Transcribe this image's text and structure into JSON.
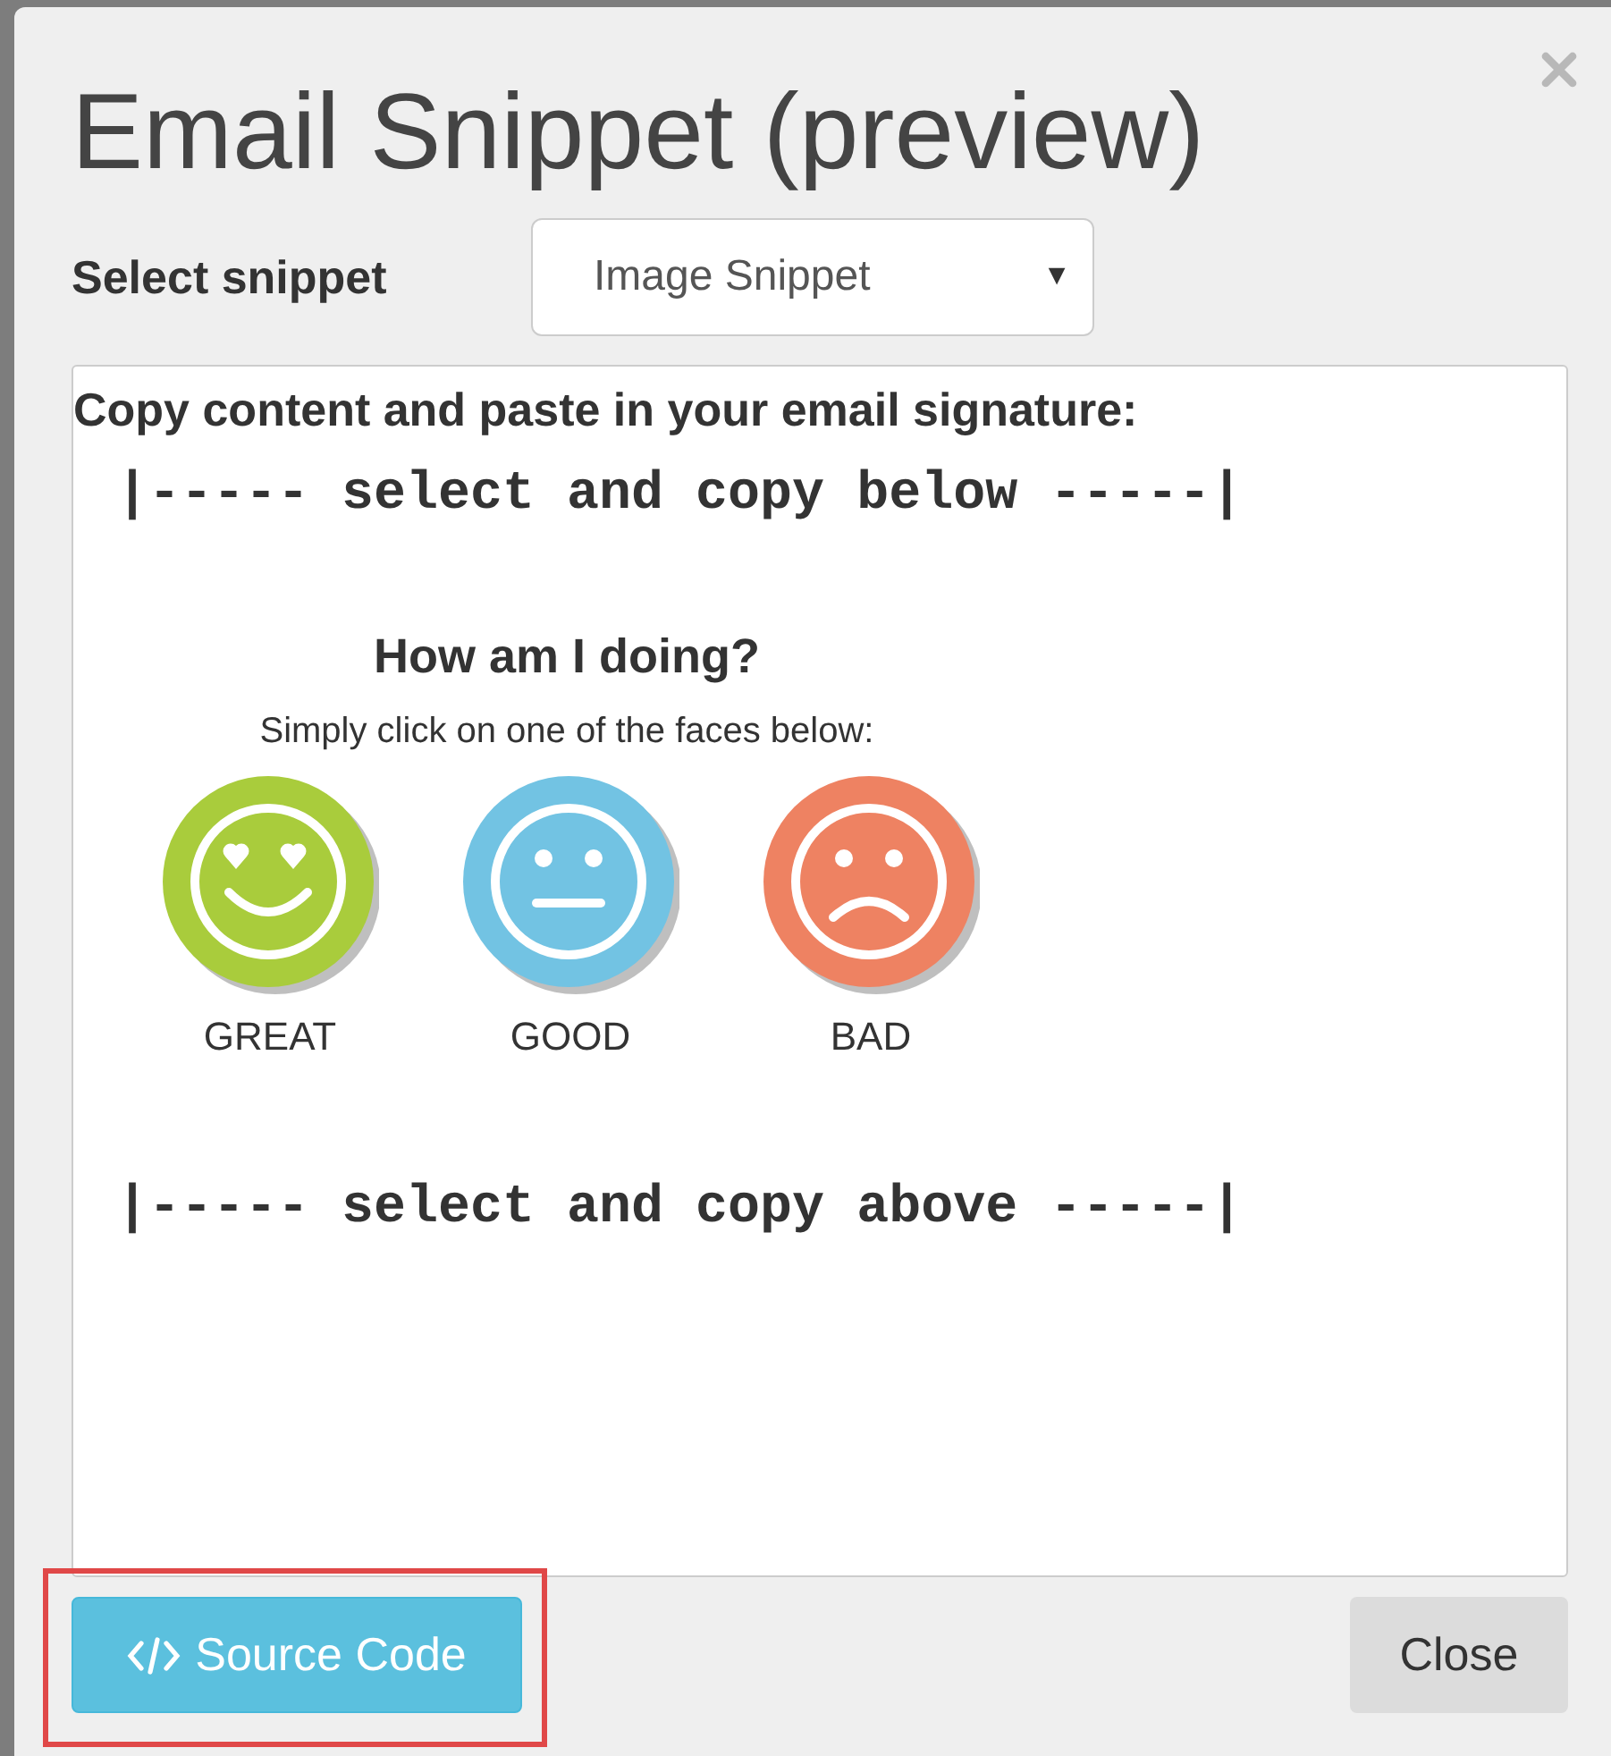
{
  "dialog": {
    "title": "Email Snippet (preview)"
  },
  "select": {
    "label": "Select snippet",
    "value": "Image Snippet",
    "caret": "▼"
  },
  "content": {
    "heading": "Copy content and paste in your email signature:",
    "copy_below": "|----- select and copy below -----|",
    "copy_above": "|----- select and copy above -----|"
  },
  "snippet": {
    "heading": "How am I doing?",
    "subheading": "Simply click on one of the faces below:",
    "faces": [
      {
        "label": "GREAT",
        "kind": "love",
        "color": "#a9cc3c"
      },
      {
        "label": "GOOD",
        "kind": "neutral",
        "color": "#72c3e3"
      },
      {
        "label": "BAD",
        "kind": "sad",
        "color": "#ee8262"
      }
    ]
  },
  "buttons": {
    "source_code": "Source Code",
    "close": "Close",
    "source_code_highlighted": true
  }
}
